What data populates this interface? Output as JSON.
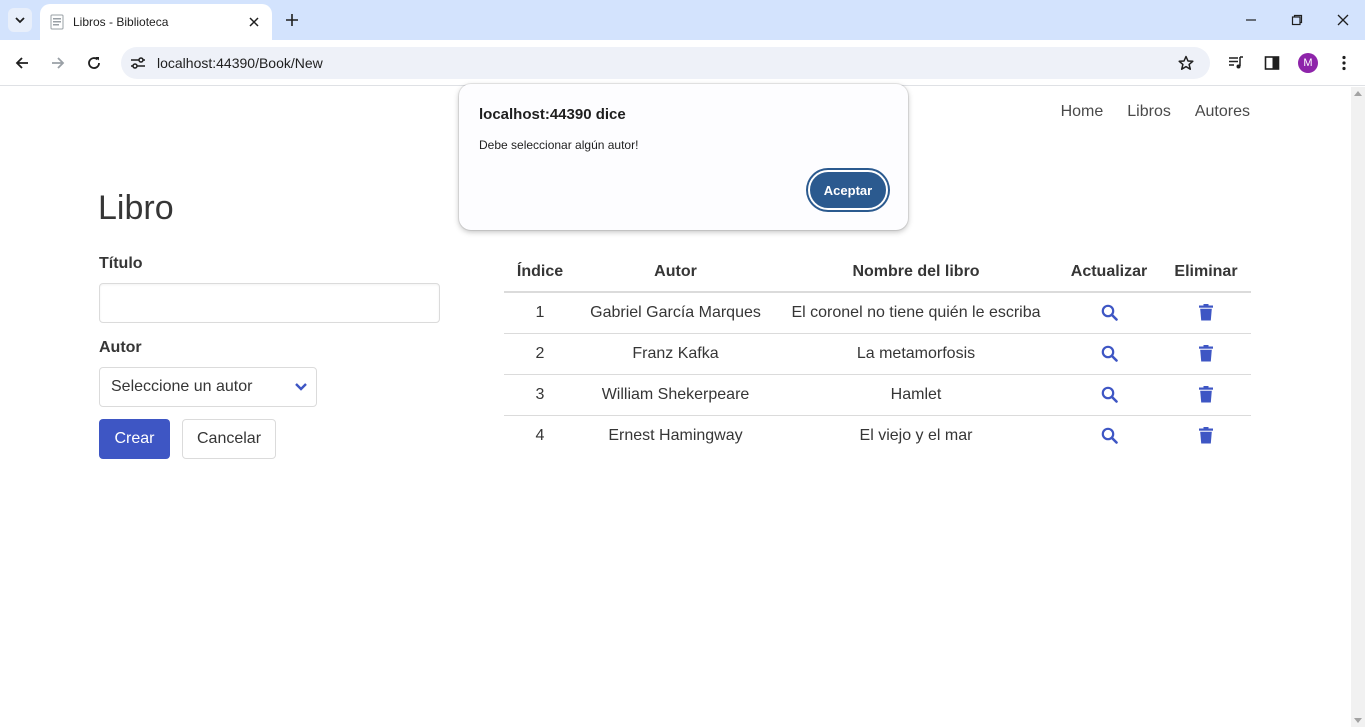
{
  "browser": {
    "tab_title": "Libros - Biblioteca",
    "url": "localhost:44390/Book/New",
    "profile_initial": "M"
  },
  "nav": {
    "items": [
      "Home",
      "Libros",
      "Autores"
    ]
  },
  "form": {
    "title": "Libro",
    "titulo_label": "Título",
    "titulo_value": "",
    "autor_label": "Autor",
    "autor_selected": "Seleccione un autor",
    "create_label": "Crear",
    "cancel_label": "Cancelar"
  },
  "table": {
    "headers": [
      "Índice",
      "Autor",
      "Nombre del libro",
      "Actualizar",
      "Eliminar"
    ],
    "rows": [
      {
        "index": "1",
        "author": "Gabriel García Marques",
        "book": "El coronel no tiene quién le escriba"
      },
      {
        "index": "2",
        "author": "Franz Kafka",
        "book": "La metamorfosis"
      },
      {
        "index": "3",
        "author": "William Shekerpeare",
        "book": "Hamlet"
      },
      {
        "index": "4",
        "author": "Ernest Hamingway",
        "book": "El viejo y el mar"
      }
    ],
    "icons": {
      "update": "search-icon",
      "delete": "trash-icon"
    }
  },
  "dialog": {
    "title": "localhost:44390 dice",
    "message": "Debe seleccionar algún autor!",
    "ok_label": "Aceptar"
  },
  "colors": {
    "primary": "#3e56c4",
    "icon": "#3e56c4",
    "dialog_button": "#2b5a8f",
    "tabstrip": "#d3e3fd"
  }
}
